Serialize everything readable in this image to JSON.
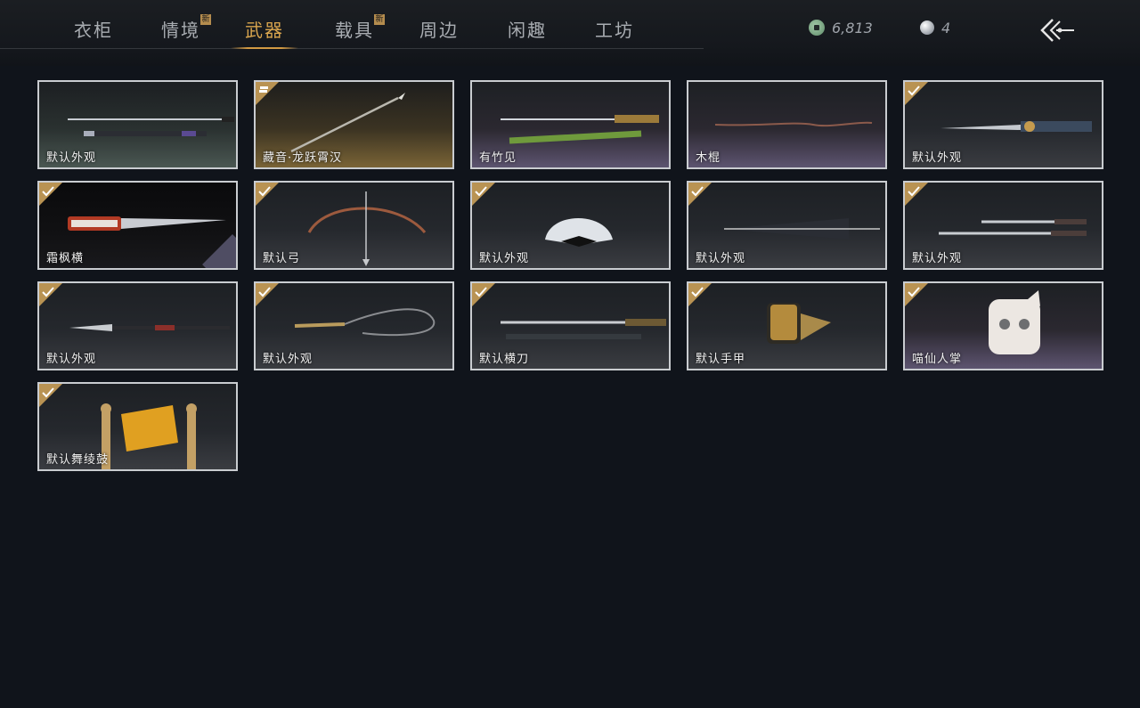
{
  "tabs": [
    {
      "label": "衣柜",
      "new": false,
      "active": false
    },
    {
      "label": "情境",
      "new": true,
      "active": false
    },
    {
      "label": "武器",
      "new": false,
      "active": true
    },
    {
      "label": "载具",
      "new": true,
      "active": false
    },
    {
      "label": "周边",
      "new": false,
      "active": false
    },
    {
      "label": "闲趣",
      "new": false,
      "active": false
    },
    {
      "label": "工坊",
      "new": false,
      "active": false
    }
  ],
  "new_badge": "新",
  "currency": {
    "coins": "6,813",
    "pearls": "4"
  },
  "items": [
    {
      "label": "默认外观",
      "status": "none",
      "icon": "sword-with-sheath-icon"
    },
    {
      "label": "藏音·龙跃霄汉",
      "status": "stacked",
      "icon": "spear-icon"
    },
    {
      "label": "有竹见",
      "status": "none",
      "icon": "bamboo-sword-icon"
    },
    {
      "label": "木棍",
      "status": "none",
      "icon": "wooden-stick-icon"
    },
    {
      "label": "默认外观",
      "status": "equipped",
      "icon": "ornate-sword-icon"
    },
    {
      "label": "霜枫横",
      "status": "equipped",
      "icon": "red-glowing-blade-icon"
    },
    {
      "label": "默认弓",
      "status": "equipped",
      "icon": "bow-icon"
    },
    {
      "label": "默认外观",
      "status": "equipped",
      "icon": "folding-fan-icon"
    },
    {
      "label": "默认外观",
      "status": "equipped",
      "icon": "umbrella-icon"
    },
    {
      "label": "默认外观",
      "status": "equipped",
      "icon": "twin-swords-icon"
    },
    {
      "label": "默认外观",
      "status": "equipped",
      "icon": "glaive-icon"
    },
    {
      "label": "默认外观",
      "status": "equipped",
      "icon": "rope-dart-icon"
    },
    {
      "label": "默认横刀",
      "status": "equipped",
      "icon": "hengdao-icon"
    },
    {
      "label": "默认手甲",
      "status": "equipped",
      "icon": "gauntlet-icon"
    },
    {
      "label": "喵仙人掌",
      "status": "equipped",
      "icon": "cat-paw-icon"
    },
    {
      "label": "默认舞绫鼓",
      "status": "equipped",
      "icon": "dance-drum-icon"
    }
  ]
}
